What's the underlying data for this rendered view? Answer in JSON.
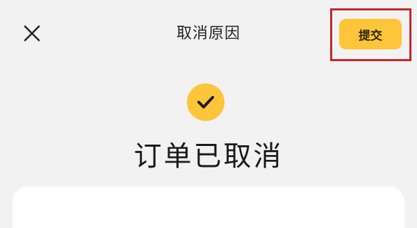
{
  "header": {
    "title": "取消原因",
    "submit_label": "提交"
  },
  "status": {
    "message": "订单已取消"
  },
  "icons": {
    "close": "close-icon",
    "success": "checkmark-icon"
  },
  "colors": {
    "accent": "#fcc53a",
    "highlight_border": "#c0282c",
    "background": "#f2f2f2",
    "card": "#ffffff"
  }
}
